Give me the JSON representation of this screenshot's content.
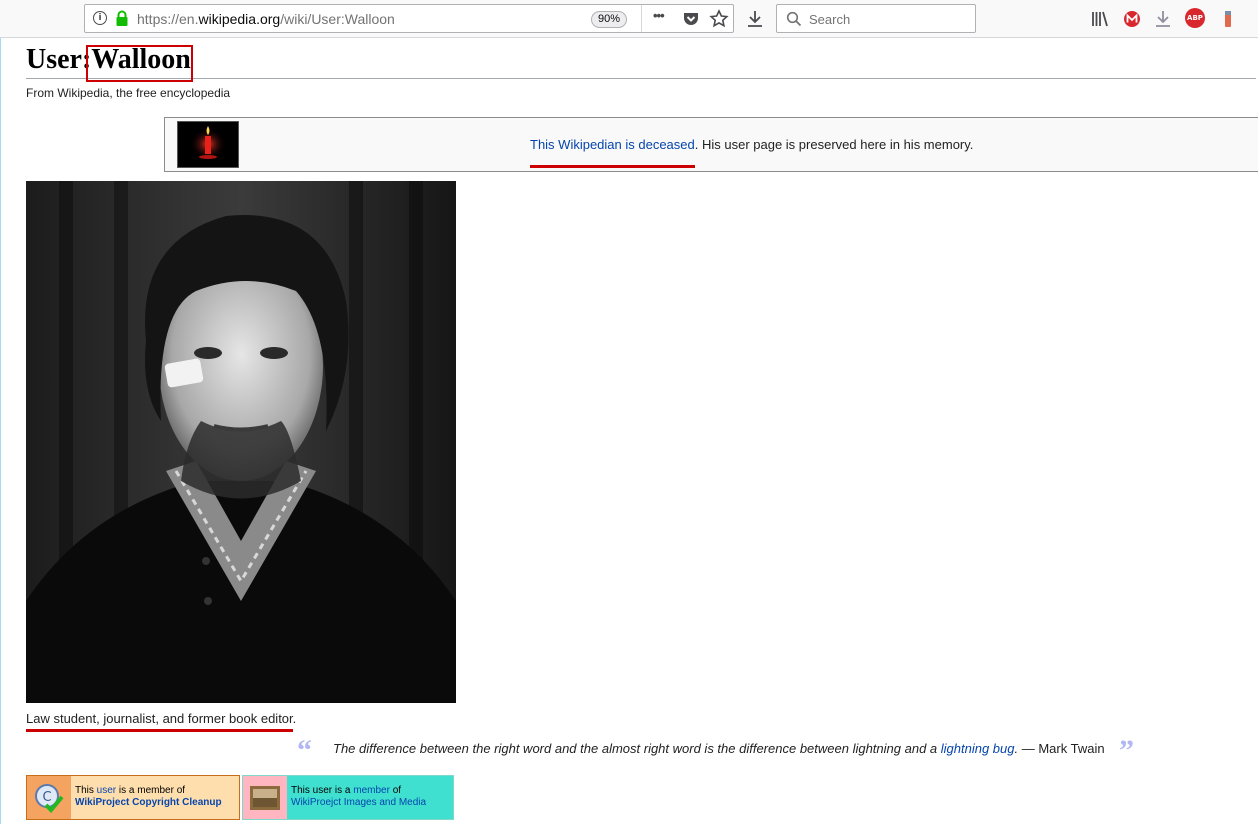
{
  "browser": {
    "url_prefix": "https://en.",
    "url_domain": "wikipedia.org",
    "url_path": "/wiki/User:Walloon",
    "zoom": "90%",
    "search_placeholder": "Search",
    "info_glyph": "i",
    "menu_glyph": "•••",
    "addon_abp": "ABP"
  },
  "page": {
    "title_prefix": "User:",
    "title_name": "Walloon",
    "tagline": "From Wikipedia, the free encyclopedia",
    "memorial_link": "This Wikipedian is deceased",
    "memorial_text": ". His user page is preserved here in his memory.",
    "caption": "Law student, journalist, and former book editor.",
    "quote": {
      "open_mark": "“",
      "close_mark": "”",
      "text_before_link": "The difference between the right word and the almost right word is the difference between lightning and a ",
      "link": "lightning bug",
      "text_after_link": ".",
      "attribution": " — Mark Twain"
    },
    "userboxes": [
      {
        "line1_pre": "This ",
        "line1_link": "user",
        "line1_post": " is a member of",
        "line2": "WikiProject Copyright Cleanup",
        "bg": "#ffdead",
        "icon_bg": "#f4a460",
        "border": "#c76e1a"
      },
      {
        "line1_pre": "This user is a ",
        "line1_link": "member",
        "line1_post": " of",
        "line2": "WikiProejct Images and Media",
        "bg": "#40e0d0",
        "icon_bg": "#ffb6c1",
        "border": "#7fd8cc"
      }
    ]
  },
  "colors": {
    "link": "#0645ad",
    "annotation_red": "#cc0000"
  }
}
